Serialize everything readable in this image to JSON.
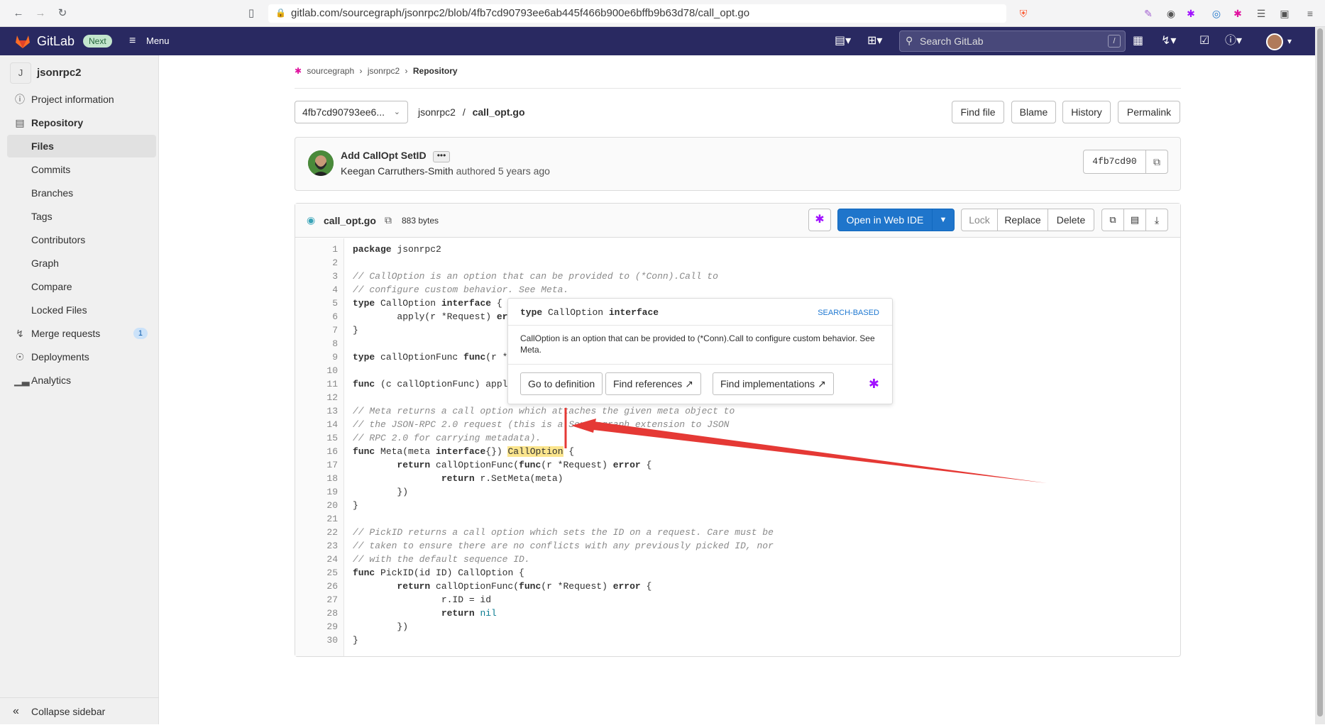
{
  "browser": {
    "url": "gitlab.com/sourcegraph/jsonrpc2/blob/4fb7cd90793ee6ab445f466b900e6bffb9b63d78/call_opt.go"
  },
  "topnav": {
    "brand": "GitLab",
    "next_badge": "Next",
    "menu_label": "Menu",
    "search_placeholder": "Search GitLab",
    "search_shortcut": "/"
  },
  "sidebar": {
    "project_initial": "J",
    "project_name": "jsonrpc2",
    "items": [
      {
        "label": "Project information"
      },
      {
        "label": "Repository"
      },
      {
        "label": "Files"
      },
      {
        "label": "Commits"
      },
      {
        "label": "Branches"
      },
      {
        "label": "Tags"
      },
      {
        "label": "Contributors"
      },
      {
        "label": "Graph"
      },
      {
        "label": "Compare"
      },
      {
        "label": "Locked Files"
      },
      {
        "label": "Merge requests",
        "badge": "1"
      },
      {
        "label": "Deployments"
      },
      {
        "label": "Analytics"
      }
    ],
    "collapse_label": "Collapse sidebar"
  },
  "breadcrumb": {
    "org": "sourcegraph",
    "project": "jsonrpc2",
    "current": "Repository"
  },
  "toolbar": {
    "ref": "4fb7cd90793ee6...",
    "path_root": "jsonrpc2",
    "path_sep": "/",
    "path_file": "call_opt.go",
    "find_file": "Find file",
    "blame": "Blame",
    "history": "History",
    "permalink": "Permalink"
  },
  "commit": {
    "title": "Add CallOpt SetID",
    "dots": "•••",
    "author": "Keegan Carruthers-Smith",
    "authored": "authored",
    "when": "5 years ago",
    "sha": "4fb7cd90"
  },
  "file": {
    "name": "call_opt.go",
    "size": "883 bytes",
    "open_web_ide": "Open in Web IDE",
    "lock": "Lock",
    "replace": "Replace",
    "delete": "Delete"
  },
  "code": {
    "line_numbers": [
      "1",
      "2",
      "3",
      "4",
      "5",
      "6",
      "7",
      "8",
      "9",
      "10",
      "11",
      "12",
      "13",
      "14",
      "15",
      "16",
      "17",
      "18",
      "19",
      "20",
      "21",
      "22",
      "23",
      "24",
      "25",
      "26",
      "27",
      "28",
      "29",
      "30"
    ]
  },
  "popover": {
    "sig_kw": "type",
    "sig_name": "CallOption",
    "sig_kw2": "interface",
    "tag": "SEARCH-BASED",
    "doc": "CallOption is an option that can be provided to (*Conn).Call to configure custom behavior. See Meta.",
    "go_to_definition": "Go to definition",
    "find_references": "Find references",
    "find_implementations": "Find implementations"
  },
  "colors": {
    "topnav": "#292961",
    "primary": "#1f75cb",
    "highlight": "#fbe58d",
    "annotation_arrow": "#e53935"
  }
}
